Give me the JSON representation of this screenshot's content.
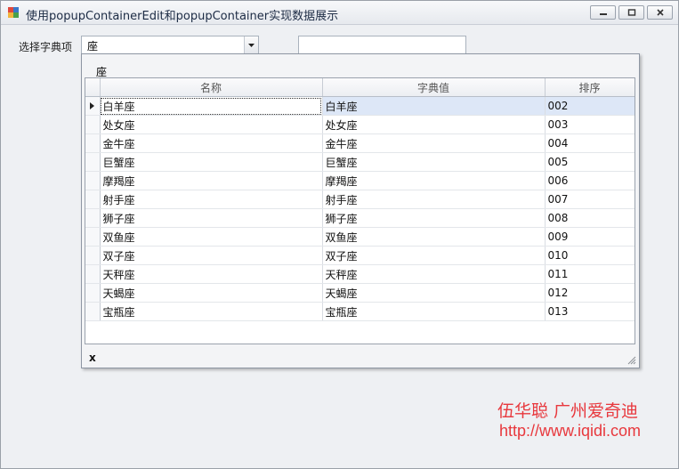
{
  "window": {
    "title": "使用popupContainerEdit和popupContainer实现数据展示"
  },
  "form": {
    "select_label": "选择字典项",
    "combo_value": "座",
    "textbox_value": ""
  },
  "popup": {
    "filter_text": "座",
    "columns": [
      "名称",
      "字典值",
      "排序"
    ],
    "rows": [
      {
        "name": "白羊座",
        "value": "白羊座",
        "order": "002"
      },
      {
        "name": "处女座",
        "value": "处女座",
        "order": "003"
      },
      {
        "name": "金牛座",
        "value": "金牛座",
        "order": "004"
      },
      {
        "name": "巨蟹座",
        "value": "巨蟹座",
        "order": "005"
      },
      {
        "name": "摩羯座",
        "value": "摩羯座",
        "order": "006"
      },
      {
        "name": "射手座",
        "value": "射手座",
        "order": "007"
      },
      {
        "name": "狮子座",
        "value": "狮子座",
        "order": "008"
      },
      {
        "name": "双鱼座",
        "value": "双鱼座",
        "order": "009"
      },
      {
        "name": "双子座",
        "value": "双子座",
        "order": "010"
      },
      {
        "name": "天秤座",
        "value": "天秤座",
        "order": "011"
      },
      {
        "name": "天蝎座",
        "value": "天蝎座",
        "order": "012"
      },
      {
        "name": "宝瓶座",
        "value": "宝瓶座",
        "order": "013"
      }
    ],
    "focused_row": 0,
    "close_glyph": "x"
  },
  "footer": {
    "author": "伍华聪  广州爱奇迪",
    "url": "http://www.iqidi.com"
  },
  "colors": {
    "accent_red": "#e8383d",
    "focused_row_bg": "#dde7f7"
  }
}
